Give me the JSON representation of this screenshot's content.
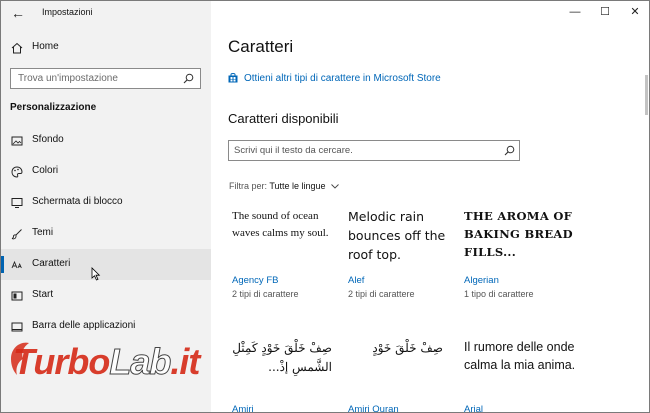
{
  "app": {
    "title": "Impostazioni"
  },
  "window_controls": {
    "minimize": "—",
    "maximize": "☐",
    "close": "✕"
  },
  "sidebar": {
    "home_label": "Home",
    "search_placeholder": "Trova un'impostazione",
    "section_title": "Personalizzazione",
    "items": [
      {
        "label": "Sfondo",
        "icon": "image-icon"
      },
      {
        "label": "Colori",
        "icon": "palette-icon"
      },
      {
        "label": "Schermata di blocco",
        "icon": "monitor-icon"
      },
      {
        "label": "Temi",
        "icon": "brush-icon"
      },
      {
        "label": "Caratteri",
        "icon": "font-icon"
      },
      {
        "label": "Start",
        "icon": "start-icon"
      },
      {
        "label": "Barra delle applicazioni",
        "icon": "taskbar-icon"
      }
    ]
  },
  "main": {
    "title": "Caratteri",
    "store_link": "Ottieni altri tipi di carattere in Microsoft Store",
    "available_title": "Caratteri disponibili",
    "search_placeholder": "Scrivi qui il testo da cercare.",
    "filter_label": "Filtra per:",
    "filter_value": "Tutte le lingue",
    "fonts": [
      {
        "preview": "The sound of ocean waves calms my soul.",
        "name": "Agency FB",
        "count": "2 tipi di carattere"
      },
      {
        "preview": "Melodic rain bounces off the roof top.",
        "name": "Alef",
        "count": "2 tipi di carattere"
      },
      {
        "preview": "THE AROMA OF BAKING BREAD FILLS...",
        "name": "Algerian",
        "count": "1 tipo di carattere"
      },
      {
        "preview": "صِفْ خَلْقَ خَوْدٍ كَمِثْلِ الشَّمسِ إذْ...",
        "name": "Amiri",
        "count": ""
      },
      {
        "preview": "صِفْ خَلْقَ خَوْدٍ",
        "name": "Amiri Quran",
        "count": ""
      },
      {
        "preview": "Il rumore delle onde calma la mia anima.",
        "name": "Arial",
        "count": ""
      }
    ]
  },
  "watermark": {
    "text_red": "Turbo",
    "text_white": "Lab",
    "text_end": ".it"
  }
}
